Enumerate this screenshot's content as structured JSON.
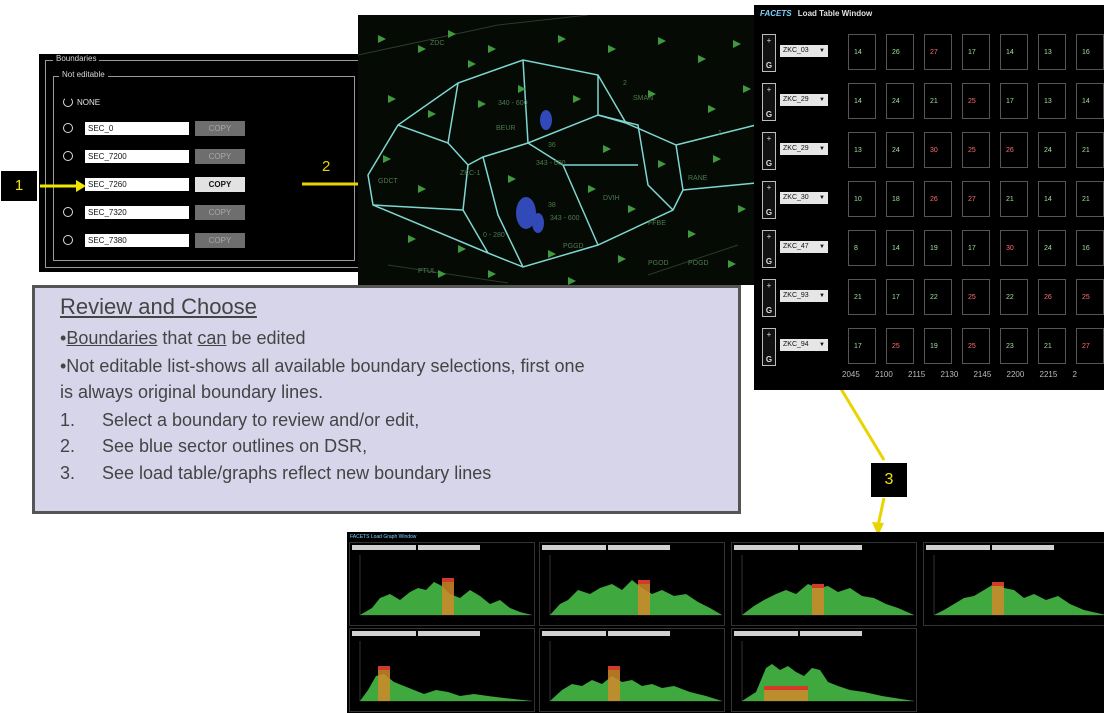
{
  "boundaries": {
    "frame_title": "Boundaries",
    "group_title": "Not editable",
    "none_label": "NONE",
    "rows": [
      {
        "name": "SEC_0",
        "copy": "COPY",
        "active": false
      },
      {
        "name": "SEC_7200",
        "copy": "COPY",
        "active": false
      },
      {
        "name": "SEC_7260",
        "copy": "COPY",
        "active": true
      },
      {
        "name": "SEC_7320",
        "copy": "COPY",
        "active": false
      },
      {
        "name": "SEC_7380",
        "copy": "COPY",
        "active": false
      }
    ]
  },
  "callouts": {
    "one": "1",
    "two": "2",
    "three": "3"
  },
  "map": {
    "labels": [
      "ZDC",
      "340 - 600",
      "0 - 280",
      "343 - 600",
      "GDCT",
      "ZKC-1",
      "343 - 600",
      "BEUR",
      "SMAN",
      "DVIH",
      "FFBE",
      "PGGD",
      "PGOD",
      "POGD",
      "PTUL",
      "RANE",
      "36",
      "38",
      "2",
      "1"
    ]
  },
  "load_table": {
    "title": "Load Table Window",
    "logo": "FACETS",
    "g_label": "G",
    "rows": [
      {
        "sector": "ZKC_03",
        "values": [
          {
            "v": "14",
            "red": false
          },
          {
            "v": "26",
            "red": false
          },
          {
            "v": "27",
            "red": true
          },
          {
            "v": "17",
            "red": false
          },
          {
            "v": "14",
            "red": false
          },
          {
            "v": "13",
            "red": false
          },
          {
            "v": "16",
            "red": false
          }
        ]
      },
      {
        "sector": "ZKC_29",
        "values": [
          {
            "v": "14",
            "red": false
          },
          {
            "v": "24",
            "red": false
          },
          {
            "v": "21",
            "red": false
          },
          {
            "v": "25",
            "red": true
          },
          {
            "v": "17",
            "red": false
          },
          {
            "v": "13",
            "red": false
          },
          {
            "v": "14",
            "red": false
          }
        ]
      },
      {
        "sector": "ZKC_29",
        "values": [
          {
            "v": "13",
            "red": false
          },
          {
            "v": "24",
            "red": false
          },
          {
            "v": "30",
            "red": true
          },
          {
            "v": "25",
            "red": true
          },
          {
            "v": "26",
            "red": true
          },
          {
            "v": "24",
            "red": false
          },
          {
            "v": "21",
            "red": false
          }
        ]
      },
      {
        "sector": "ZKC_30",
        "values": [
          {
            "v": "10",
            "red": false
          },
          {
            "v": "18",
            "red": false
          },
          {
            "v": "26",
            "red": true
          },
          {
            "v": "27",
            "red": true
          },
          {
            "v": "21",
            "red": false
          },
          {
            "v": "14",
            "red": false
          },
          {
            "v": "21",
            "red": false
          }
        ]
      },
      {
        "sector": "ZKC_47",
        "values": [
          {
            "v": "8",
            "red": false
          },
          {
            "v": "14",
            "red": false
          },
          {
            "v": "19",
            "red": false
          },
          {
            "v": "17",
            "red": false
          },
          {
            "v": "30",
            "red": true
          },
          {
            "v": "24",
            "red": false
          },
          {
            "v": "16",
            "red": false
          }
        ]
      },
      {
        "sector": "ZKC_93",
        "values": [
          {
            "v": "21",
            "red": false
          },
          {
            "v": "17",
            "red": false
          },
          {
            "v": "22",
            "red": false
          },
          {
            "v": "25",
            "red": true
          },
          {
            "v": "22",
            "red": false
          },
          {
            "v": "26",
            "red": true
          },
          {
            "v": "25",
            "red": true
          }
        ]
      },
      {
        "sector": "ZKC_94",
        "values": [
          {
            "v": "17",
            "red": false
          },
          {
            "v": "25",
            "red": true
          },
          {
            "v": "19",
            "red": false
          },
          {
            "v": "25",
            "red": true
          },
          {
            "v": "23",
            "red": false
          },
          {
            "v": "21",
            "red": false
          },
          {
            "v": "27",
            "red": true
          }
        ]
      }
    ],
    "times": "2045 2100 2115 2130 2145 2200 2215 2"
  },
  "review": {
    "heading": "Review and Choose",
    "bullet1_pre": "•",
    "bullet1_a": "Boundaries",
    "bullet1_b": " that ",
    "bullet1_c": "can",
    "bullet1_d": " be edited",
    "bullet2_l1": "•Not editable list-shows all available boundary selections, first one",
    "bullet2_l2": "is always original boundary lines.",
    "items": [
      {
        "num": "1.",
        "text": "Select a boundary to review and/or edit,"
      },
      {
        "num": "2.",
        "text": "See blue sector outlines on DSR,"
      },
      {
        "num": "3.",
        "text": "See load table/graphs reflect new boundary lines"
      }
    ]
  },
  "graph_window": {
    "title": "FACETS Load Graph Window"
  },
  "colors": {
    "accent_yellow": "#f2e600",
    "map_line": "#7fd6d0",
    "aircraft": "#3f9a3f",
    "graph_green": "#3fa83f",
    "graph_orange": "#d08a2a",
    "graph_red": "#d23a2a",
    "panel_lavender": "#d6d5ea"
  }
}
